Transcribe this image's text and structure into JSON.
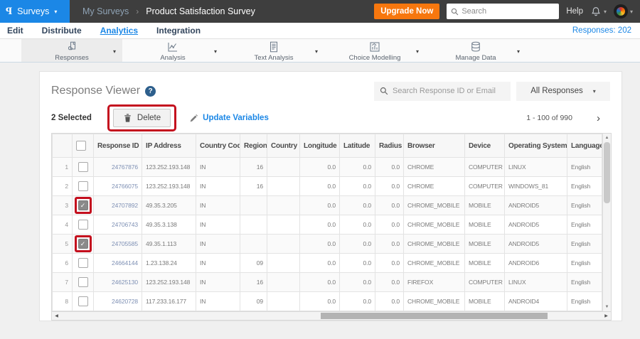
{
  "colors": {
    "accent_blue": "#1b87e6",
    "upgrade_orange": "#f7770e",
    "topbar_dark": "#3e3e3e",
    "annotation_red": "#c40f1e"
  },
  "topbar": {
    "logo_letter": "P",
    "product_menu": "Surveys",
    "breadcrumb_parent": "My Surveys",
    "breadcrumb_separator": "›",
    "breadcrumb_current": "Product Satisfaction Survey",
    "upgrade_label": "Upgrade Now",
    "search_placeholder": "Search",
    "help_label": "Help"
  },
  "nav": {
    "items": [
      "Edit",
      "Distribute",
      "Analytics",
      "Integration"
    ],
    "active": "Analytics",
    "responses_count": "Responses: 202"
  },
  "toolbar": {
    "items": [
      {
        "label": "Responses",
        "icon": "responses-icon",
        "selected": true
      },
      {
        "label": "Analysis",
        "icon": "analysis-icon",
        "selected": false
      },
      {
        "label": "Text Analysis",
        "icon": "text-analysis-icon",
        "selected": false
      },
      {
        "label": "Choice Modelling",
        "icon": "choice-modelling-icon",
        "selected": false
      },
      {
        "label": "Manage Data",
        "icon": "manage-data-icon",
        "selected": false
      }
    ]
  },
  "viewer": {
    "title": "Response Viewer",
    "help_badge": "?",
    "search_placeholder": "Search Response ID or Email",
    "filter_value": "All Responses",
    "selected_count": "2 Selected",
    "delete_label": "Delete",
    "update_variables_label": "Update Variables",
    "pagination": "1 - 100 of 990"
  },
  "table": {
    "columns": [
      "",
      "",
      "Response ID",
      "IP Address",
      "Country Code",
      "Region",
      "Country",
      "Longitude",
      "Latitude",
      "Radius",
      "Browser",
      "Device",
      "Operating System",
      "Language"
    ],
    "sort_column": "Response ID",
    "sort_direction": "asc",
    "rows": [
      {
        "num": "1",
        "checked": false,
        "highlight": false,
        "response_id": "24767876",
        "ip": "123.252.193.148",
        "country_code": "IN",
        "region": "16",
        "country": "",
        "longitude": "0.0",
        "latitude": "0.0",
        "radius": "0.0",
        "browser": "CHROME",
        "device": "COMPUTER",
        "os": "LINUX",
        "language": "English"
      },
      {
        "num": "2",
        "checked": false,
        "highlight": false,
        "response_id": "24766075",
        "ip": "123.252.193.148",
        "country_code": "IN",
        "region": "16",
        "country": "",
        "longitude": "0.0",
        "latitude": "0.0",
        "radius": "0.0",
        "browser": "CHROME",
        "device": "COMPUTER",
        "os": "WINDOWS_81",
        "language": "English"
      },
      {
        "num": "3",
        "checked": true,
        "highlight": true,
        "response_id": "24707892",
        "ip": "49.35.3.205",
        "country_code": "IN",
        "region": "",
        "country": "",
        "longitude": "0.0",
        "latitude": "0.0",
        "radius": "0.0",
        "browser": "CHROME_MOBILE",
        "device": "MOBILE",
        "os": "ANDROID5",
        "language": "English"
      },
      {
        "num": "4",
        "checked": false,
        "highlight": false,
        "response_id": "24706743",
        "ip": "49.35.3.138",
        "country_code": "IN",
        "region": "",
        "country": "",
        "longitude": "0.0",
        "latitude": "0.0",
        "radius": "0.0",
        "browser": "CHROME_MOBILE",
        "device": "MOBILE",
        "os": "ANDROID5",
        "language": "English"
      },
      {
        "num": "5",
        "checked": true,
        "highlight": true,
        "response_id": "24705585",
        "ip": "49.35.1.113",
        "country_code": "IN",
        "region": "",
        "country": "",
        "longitude": "0.0",
        "latitude": "0.0",
        "radius": "0.0",
        "browser": "CHROME_MOBILE",
        "device": "MOBILE",
        "os": "ANDROID5",
        "language": "English"
      },
      {
        "num": "6",
        "checked": false,
        "highlight": false,
        "response_id": "24664144",
        "ip": "1.23.138.24",
        "country_code": "IN",
        "region": "09",
        "country": "",
        "longitude": "0.0",
        "latitude": "0.0",
        "radius": "0.0",
        "browser": "CHROME_MOBILE",
        "device": "MOBILE",
        "os": "ANDROID6",
        "language": "English"
      },
      {
        "num": "7",
        "checked": false,
        "highlight": false,
        "response_id": "24625130",
        "ip": "123.252.193.148",
        "country_code": "IN",
        "region": "16",
        "country": "",
        "longitude": "0.0",
        "latitude": "0.0",
        "radius": "0.0",
        "browser": "FIREFOX",
        "device": "COMPUTER",
        "os": "LINUX",
        "language": "English"
      },
      {
        "num": "8",
        "checked": false,
        "highlight": false,
        "response_id": "24620728",
        "ip": "117.233.16.177",
        "country_code": "IN",
        "region": "09",
        "country": "",
        "longitude": "0.0",
        "latitude": "0.0",
        "radius": "0.0",
        "browser": "CHROME_MOBILE",
        "device": "MOBILE",
        "os": "ANDROID4",
        "language": "English"
      }
    ]
  }
}
